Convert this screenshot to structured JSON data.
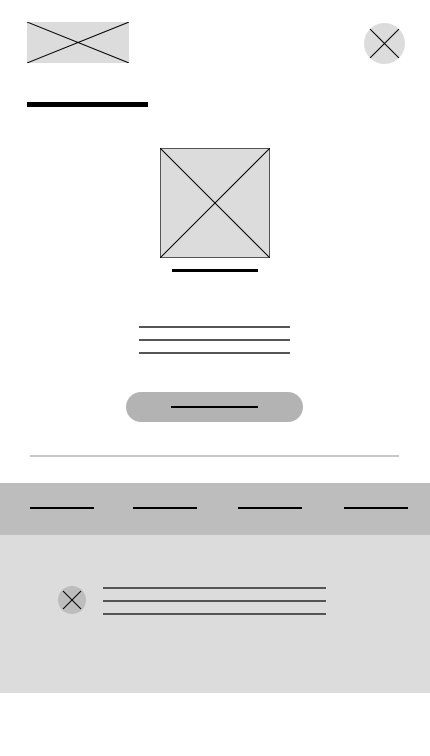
{
  "colors": {
    "placeholder_fill": "#dcdcdc",
    "button_fill": "#b3b3b3",
    "tabbar_fill": "#bdbdbd",
    "panel_fill": "#dcdcdc",
    "line_color": "#000000"
  },
  "header": {
    "logo_icon": "image-placeholder-icon",
    "close_icon": "close-icon"
  },
  "hero": {
    "image_icon": "image-placeholder-icon"
  },
  "body_text": {
    "line_count": 3
  },
  "nav": {
    "tabs": [
      {
        "id": "tab-1"
      },
      {
        "id": "tab-2"
      },
      {
        "id": "tab-3"
      },
      {
        "id": "tab-4"
      }
    ]
  },
  "list": {
    "items": [
      {
        "icon": "close-icon",
        "line_count": 3
      }
    ]
  }
}
